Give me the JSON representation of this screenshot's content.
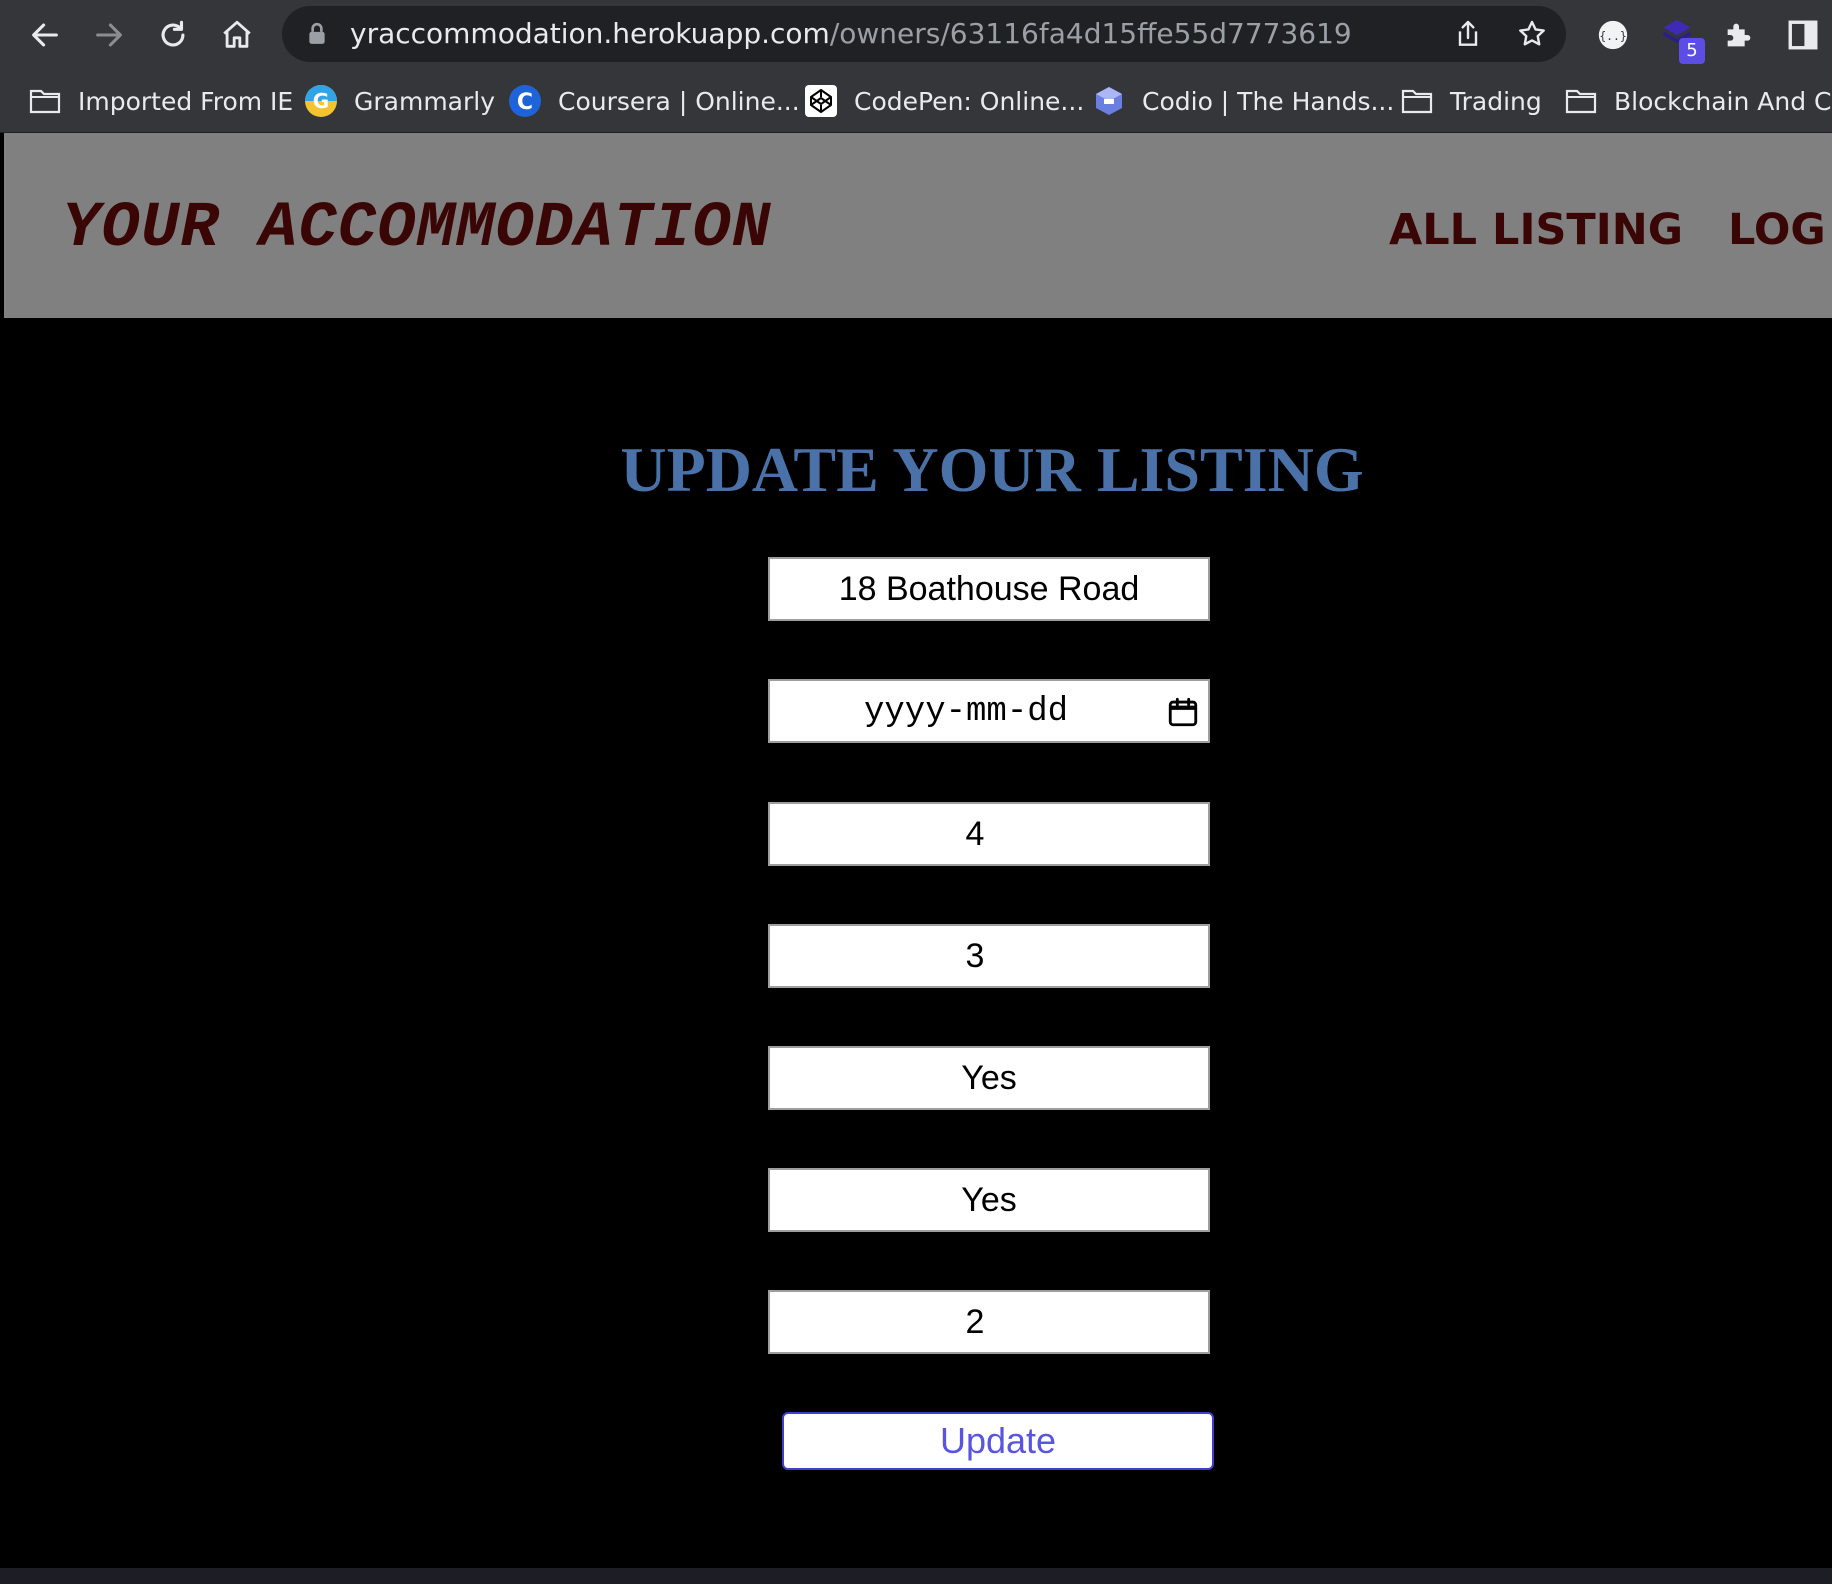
{
  "browser": {
    "url_host": "yraccommodation.herokuapp.com",
    "url_path": "/owners/63116fa4d15ffe55d7773619",
    "extension_badge": "5"
  },
  "bookmarks": [
    {
      "label": "Imported From IE",
      "icon": "folder-icon"
    },
    {
      "label": "Grammarly",
      "icon": "grammarly-icon"
    },
    {
      "label": "Coursera | Online...",
      "icon": "coursera-icon"
    },
    {
      "label": "CodePen: Online...",
      "icon": "codepen-icon"
    },
    {
      "label": "Codio | The Hands...",
      "icon": "codio-icon"
    },
    {
      "label": "Trading",
      "icon": "folder-icon"
    },
    {
      "label": "Blockchain And Cr...",
      "icon": "folder-icon"
    }
  ],
  "site": {
    "brand": "YOUR ACCOMMODATION",
    "nav": [
      "ALL LISTING",
      "LOG O"
    ]
  },
  "form": {
    "title": "UPDATE YOUR LISTING",
    "address": "18 Boathouse Road",
    "date_placeholder": "yyyy-mm-dd",
    "field_3": "4",
    "field_4": "3",
    "field_5": "Yes",
    "field_6": "Yes",
    "field_7": "2",
    "submit_label": "Update"
  },
  "colors": {
    "chrome": "#35363a",
    "header": "#808080",
    "brand_text": "#3a0505",
    "title": "#4a72a8",
    "button_text": "#5a55e0"
  }
}
